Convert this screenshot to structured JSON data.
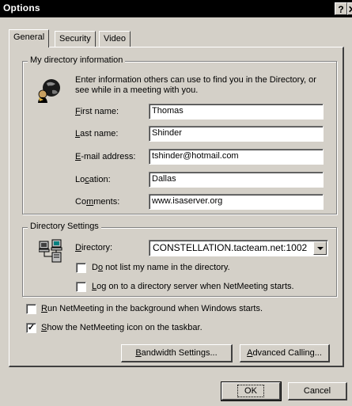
{
  "window": {
    "title": "Options",
    "help_btn": "?",
    "close_btn": "✕"
  },
  "tabs": [
    {
      "label": "General"
    },
    {
      "label": "Security"
    },
    {
      "label": "Video"
    }
  ],
  "directory_info": {
    "legend": "My directory information",
    "intro": "Enter information others can use to find you in the Directory, or see while in a meeting with you.",
    "fields": [
      {
        "label_pre": "",
        "label_u": "F",
        "label_post": "irst name:",
        "value": "Thomas"
      },
      {
        "label_pre": "",
        "label_u": "L",
        "label_post": "ast name:",
        "value": "Shinder"
      },
      {
        "label_pre": "",
        "label_u": "E",
        "label_post": "-mail address:",
        "value": "tshinder@hotmail.com"
      },
      {
        "label_pre": "Lo",
        "label_u": "c",
        "label_post": "ation:",
        "value": "Dallas"
      },
      {
        "label_pre": "Co",
        "label_u": "m",
        "label_post": "ments:",
        "value": "www.isaserver.org"
      }
    ]
  },
  "directory_settings": {
    "legend": "Directory Settings",
    "directory_label_u": "D",
    "directory_label_post": "irectory:",
    "directory_value": "CONSTELLATION.tacteam.net:1002",
    "opt1_pre": "D",
    "opt1_u": "o",
    "opt1_post": " not list my name in the directory.",
    "opt2_pre": "",
    "opt2_u": "L",
    "opt2_post": "og on to a directory server when NetMeeting starts."
  },
  "background": {
    "run_pre": "",
    "run_u": "R",
    "run_post": "un NetMeeting in the background when Windows starts.",
    "show_pre": "",
    "show_u": "S",
    "show_post": "how the NetMeeting icon on the taskbar."
  },
  "buttons": {
    "bandwidth_u": "B",
    "bandwidth_post": "andwidth Settings...",
    "advanced_u": "A",
    "advanced_post": "dvanced Calling...",
    "ok": "OK",
    "cancel": "Cancel"
  },
  "checks": {
    "no_list": false,
    "logon": false,
    "run_bg": false,
    "show_icon": true
  },
  "icons": {
    "globe": "globe-person-icon",
    "network": "network-computers-icon"
  }
}
